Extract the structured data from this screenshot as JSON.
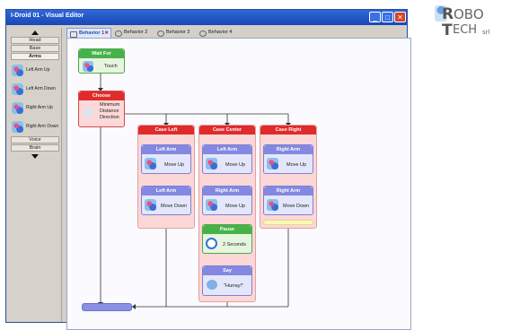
{
  "window": {
    "title": "I-Droid 01 - Visual Editor"
  },
  "tabs": [
    {
      "label": "Behavior 1"
    },
    {
      "label": "Behavior 2"
    },
    {
      "label": "Behavior 3"
    },
    {
      "label": "Behavior 4"
    }
  ],
  "sidebar": {
    "categories_top": [
      "Head",
      "Base",
      "Arms"
    ],
    "categories_bottom": [
      "Voice",
      "Brain"
    ],
    "items": [
      {
        "label": "Left Arm Up"
      },
      {
        "label": "Left Arm Down"
      },
      {
        "label": "Right Arm Up"
      },
      {
        "label": "Right Arm Down"
      }
    ]
  },
  "flow": {
    "wait_for": {
      "title": "Wait For",
      "text": "Touch"
    },
    "choose": {
      "title": "Choose",
      "text1": "Minimum",
      "text2": "Distance",
      "text3": "Direction"
    },
    "case_left": {
      "title": "Case Left",
      "b1_title": "Left Arm",
      "b1_text": "Move Up",
      "b2_title": "Left Arm",
      "b2_text": "Move Down"
    },
    "case_center": {
      "title": "Case Center",
      "b1_title": "Left Arm",
      "b1_text": "Move Up",
      "b2_title": "Right Arm",
      "b2_text": "Move Up",
      "b3_title": "Pause",
      "b3_text": "2 Seconds",
      "b4_title": "Say",
      "b4_text": "\"Hurray!\""
    },
    "case_right": {
      "title": "Case Right",
      "b1_title": "Right Arm",
      "b1_text": "Move Up",
      "b2_title": "Right Arm",
      "b2_text": "Move Down"
    }
  },
  "logo": {
    "line1_initial": "R",
    "line1_rest": "OBO",
    "line2_initial": "T",
    "line2_rest": "ECH",
    "suffix": "srl"
  },
  "colors": {
    "title_bar": "#1f4fc0",
    "case_header": "#e02b2b",
    "wait_header": "#47b24a",
    "action_header": "#8488e0"
  }
}
